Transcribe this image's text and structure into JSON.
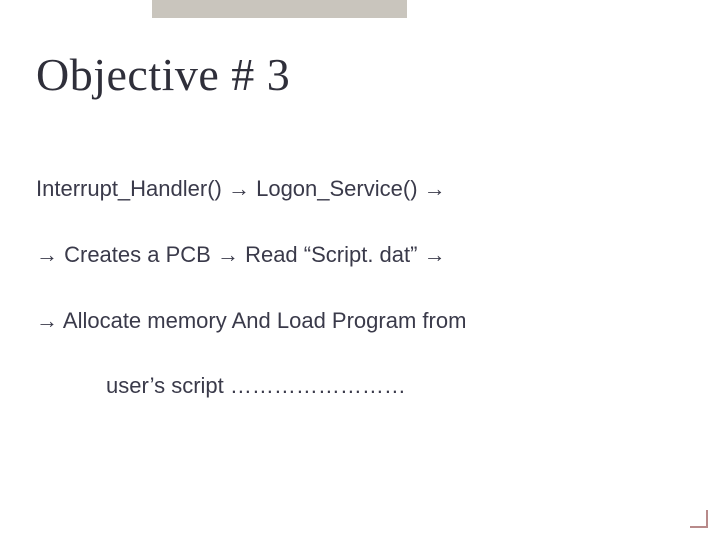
{
  "title": "Objective # 3",
  "lines": {
    "l1_a": "Interrupt_Handler()  ",
    "l1_arrow1": "→",
    "l1_b": "  Logon_Service()   ",
    "l1_arrow2": "→",
    "l2_arrow1": "→",
    "l2_a": "   Creates a PCB       ",
    "l2_arrow2": "→",
    "l2_b": "   Read “Script. dat”  ",
    "l2_arrow3": "→",
    "l3_arrow1": "→",
    "l3_a": "   Allocate memory And Load Program from",
    "l4": "user’s script ……………………"
  }
}
